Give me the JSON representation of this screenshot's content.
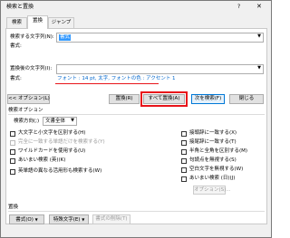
{
  "window": {
    "title": "検索と置換",
    "help": "?",
    "close": "✕"
  },
  "tabs": [
    {
      "label": "検索"
    },
    {
      "label": "置換"
    },
    {
      "label": "ジャンプ"
    }
  ],
  "find": {
    "label": "検索する文字列(N):",
    "value": "書式",
    "format_label": "書式:"
  },
  "replace": {
    "label": "置換後の文字列(I):",
    "value": "",
    "format_label": "書式:",
    "format_value": "フォント : 14 pt, 太字, フォントの色 : アクセント 1"
  },
  "buttons": {
    "less_options": "<< オプション(L)",
    "replace": "置換(R)",
    "replace_all": "すべて置換(A)",
    "find_next": "次を検索(F)",
    "close": "閉じる"
  },
  "options": {
    "section_title": "検索オプション",
    "direction_label": "検索方向(;)",
    "direction_value": "文書全体",
    "left": [
      {
        "label": "大文字と小文字を区別する(H)",
        "disabled": false
      },
      {
        "label": "完全に一致する単語だけを検索する(Y)",
        "disabled": true
      },
      {
        "label": "ワイルドカードを使用する(U)",
        "disabled": false
      },
      {
        "label": "あいまい検索 (英)(K)",
        "disabled": false
      },
      {
        "label": "英単語の異なる活用形も検索する(W)",
        "disabled": false
      }
    ],
    "right": [
      {
        "label": "接頭辞に一致する(X)"
      },
      {
        "label": "接尾辞に一致する(T)"
      },
      {
        "label": "半角と全角を区別する(M)"
      },
      {
        "label": "句読点を無視する(S)"
      },
      {
        "label": "空白文字を無視する(W)"
      },
      {
        "label": "あいまい検索 (日)(J)"
      }
    ],
    "fuzzy_options_button": "オプション(S)..."
  },
  "bottom": {
    "section_title": "置換",
    "format_button": "書式(O)",
    "special_button": "特殊文字(E)",
    "clear_format_button": "書式の削除(T)"
  },
  "colors": {
    "highlight_red": "#e8141a",
    "selection_blue": "#3399ff",
    "focus_blue": "#0078d7",
    "link_blue": "#0066cc"
  }
}
